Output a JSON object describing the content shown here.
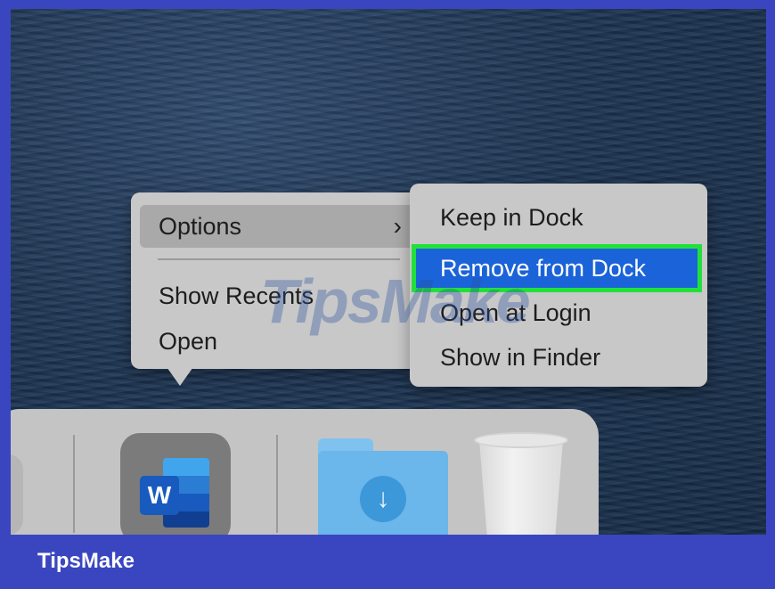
{
  "context_menu": {
    "items": [
      {
        "label": "Options",
        "has_submenu": true,
        "chevron": "›"
      },
      {
        "label": "Show Recents"
      },
      {
        "label": "Open"
      }
    ]
  },
  "submenu": {
    "items": [
      {
        "label": "Keep in Dock"
      },
      {
        "label": "Remove from Dock",
        "highlighted": true
      },
      {
        "label": "Open at Login"
      },
      {
        "label": "Show in Finder"
      }
    ]
  },
  "watermark": "TipsMake",
  "dock": {
    "apps": [
      {
        "name": "Microsoft Word",
        "icon": "word-icon",
        "letter": "W"
      },
      {
        "name": "Downloads",
        "icon": "downloads-folder-icon",
        "glyph": "↓"
      },
      {
        "name": "Trash",
        "icon": "trash-icon"
      }
    ]
  },
  "footer": {
    "brand": "TipsMake"
  },
  "colors": {
    "highlight": "#1b63d8",
    "highlight_border": "#22e03c",
    "frame": "#3a46c0"
  }
}
